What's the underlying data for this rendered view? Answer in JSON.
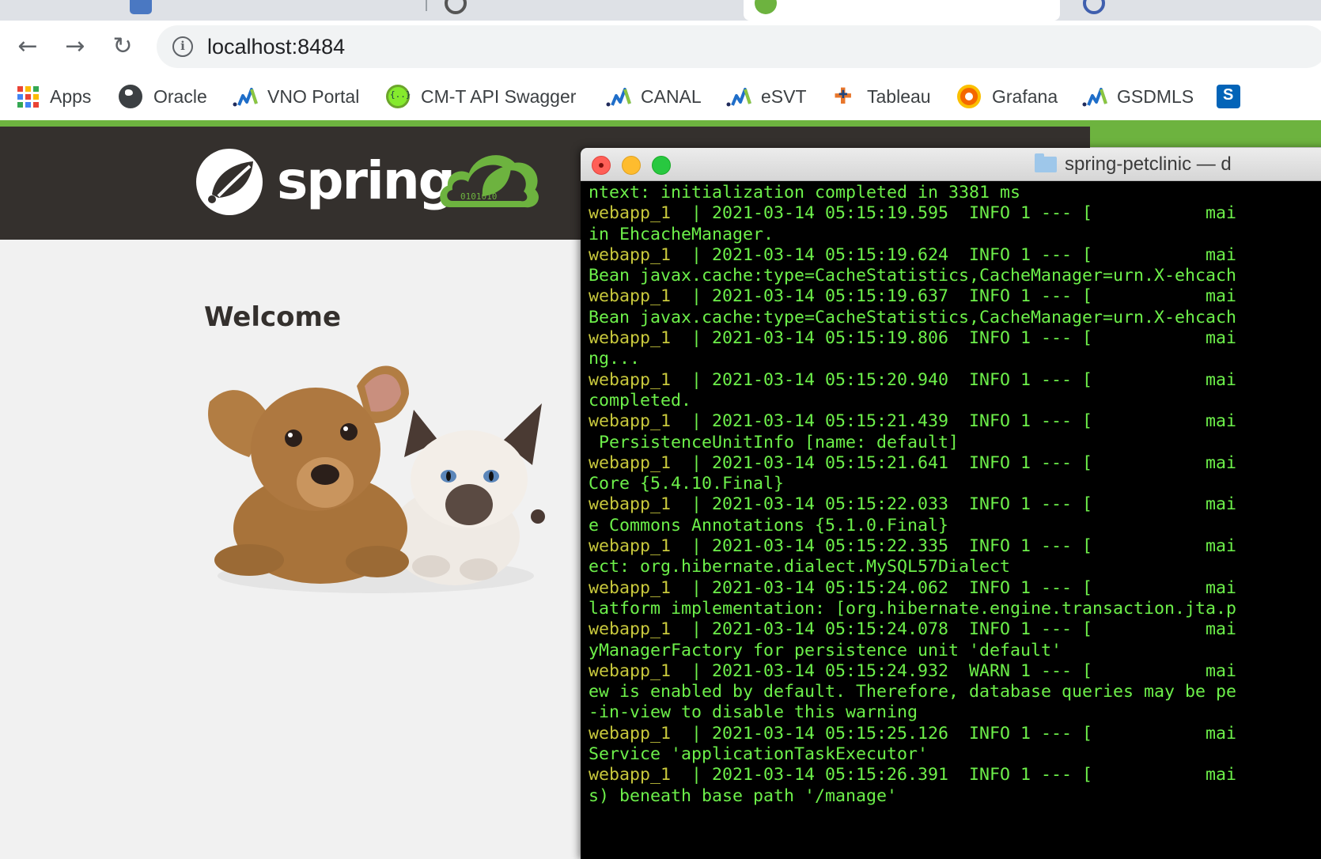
{
  "browser": {
    "url": "localhost:8484",
    "bookmarks": [
      {
        "label": "Apps",
        "icon": "apps-grid-icon"
      },
      {
        "label": "Oracle",
        "icon": "globe-icon"
      },
      {
        "label": "VNO Portal",
        "icon": "chart-bars-icon"
      },
      {
        "label": "CM-T API Swagger",
        "icon": "swagger-icon"
      },
      {
        "label": "CANAL",
        "icon": "chart-bars-icon"
      },
      {
        "label": "eSVT",
        "icon": "chart-bars-icon"
      },
      {
        "label": "Tableau",
        "icon": "tableau-icon"
      },
      {
        "label": "Grafana",
        "icon": "grafana-icon"
      },
      {
        "label": "GSDMLS",
        "icon": "chart-bars-icon"
      }
    ]
  },
  "page": {
    "logo_text": "spring",
    "logo_badge": "0101010",
    "welcome": "Welcome"
  },
  "terminal": {
    "title": "spring-petclinic — d",
    "lines": [
      {
        "svc": "",
        "text": "ntext: initialization completed in 3381 ms"
      },
      {
        "svc": "webapp_1",
        "text": "  | 2021-03-14 05:15:19.595  INFO 1 --- [           mai"
      },
      {
        "svc": "",
        "text": "in EhcacheManager."
      },
      {
        "svc": "webapp_1",
        "text": "  | 2021-03-14 05:15:19.624  INFO 1 --- [           mai"
      },
      {
        "svc": "",
        "text": "Bean javax.cache:type=CacheStatistics,CacheManager=urn.X-ehcach"
      },
      {
        "svc": "webapp_1",
        "text": "  | 2021-03-14 05:15:19.637  INFO 1 --- [           mai"
      },
      {
        "svc": "",
        "text": "Bean javax.cache:type=CacheStatistics,CacheManager=urn.X-ehcach"
      },
      {
        "svc": "webapp_1",
        "text": "  | 2021-03-14 05:15:19.806  INFO 1 --- [           mai"
      },
      {
        "svc": "",
        "text": "ng..."
      },
      {
        "svc": "webapp_1",
        "text": "  | 2021-03-14 05:15:20.940  INFO 1 --- [           mai"
      },
      {
        "svc": "",
        "text": "completed."
      },
      {
        "svc": "webapp_1",
        "text": "  | 2021-03-14 05:15:21.439  INFO 1 --- [           mai"
      },
      {
        "svc": "",
        "text": " PersistenceUnitInfo [name: default]"
      },
      {
        "svc": "webapp_1",
        "text": "  | 2021-03-14 05:15:21.641  INFO 1 --- [           mai"
      },
      {
        "svc": "",
        "text": "Core {5.4.10.Final}"
      },
      {
        "svc": "webapp_1",
        "text": "  | 2021-03-14 05:15:22.033  INFO 1 --- [           mai"
      },
      {
        "svc": "",
        "text": "e Commons Annotations {5.1.0.Final}"
      },
      {
        "svc": "webapp_1",
        "text": "  | 2021-03-14 05:15:22.335  INFO 1 --- [           mai"
      },
      {
        "svc": "",
        "text": "ect: org.hibernate.dialect.MySQL57Dialect"
      },
      {
        "svc": "webapp_1",
        "text": "  | 2021-03-14 05:15:24.062  INFO 1 --- [           mai"
      },
      {
        "svc": "",
        "text": "latform implementation: [org.hibernate.engine.transaction.jta.p"
      },
      {
        "svc": "webapp_1",
        "text": "  | 2021-03-14 05:15:24.078  INFO 1 --- [           mai"
      },
      {
        "svc": "",
        "text": "yManagerFactory for persistence unit 'default'"
      },
      {
        "svc": "webapp_1",
        "text": "  | 2021-03-14 05:15:24.932  WARN 1 --- [           mai"
      },
      {
        "svc": "",
        "text": "ew is enabled by default. Therefore, database queries may be pe"
      },
      {
        "svc": "",
        "text": "-in-view to disable this warning"
      },
      {
        "svc": "webapp_1",
        "text": "  | 2021-03-14 05:15:25.126  INFO 1 --- [           mai"
      },
      {
        "svc": "",
        "text": "Service 'applicationTaskExecutor'"
      },
      {
        "svc": "webapp_1",
        "text": "  | 2021-03-14 05:15:26.391  INFO 1 --- [           mai"
      },
      {
        "svc": "",
        "text": "s) beneath base path '/manage'"
      }
    ]
  },
  "colors": {
    "spring_green": "#6db33f",
    "header_dark": "#34302d",
    "terminal_green": "#6df04a",
    "terminal_service": "#c8c83c"
  }
}
